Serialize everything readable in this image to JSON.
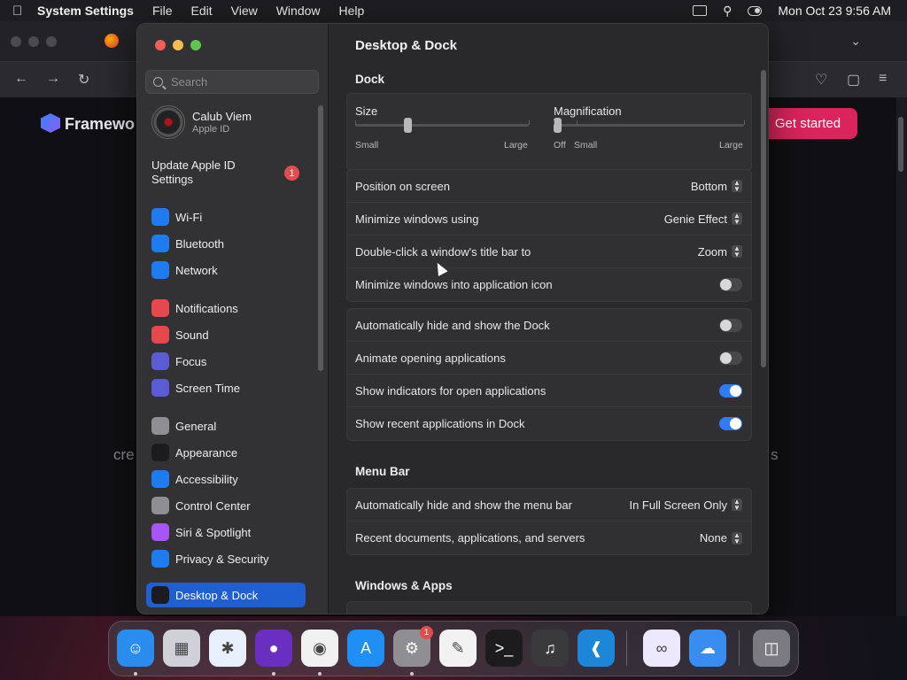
{
  "menubar": {
    "app": "System Settings",
    "items": [
      "File",
      "Edit",
      "View",
      "Window",
      "Help"
    ],
    "clock": "Mon Oct 23  9:56 AM"
  },
  "browser": {
    "brand": "Framewo",
    "cta": "Get started",
    "left_text": "cre",
    "right_text": "s"
  },
  "sidebar": {
    "search_placeholder": "Search",
    "profile_name": "Calub Viem",
    "profile_sub": "Apple ID",
    "update_label": "Update Apple ID Settings",
    "update_badge": "1",
    "items": [
      {
        "label": "Wi-Fi",
        "icon": "wifi-icon",
        "color": "#1f7cf0"
      },
      {
        "label": "Bluetooth",
        "icon": "bluetooth-icon",
        "color": "#1f7cf0"
      },
      {
        "label": "Network",
        "icon": "globe-icon",
        "color": "#1f7cf0"
      },
      {
        "label": "Notifications",
        "icon": "bell-icon",
        "color": "#e5484d"
      },
      {
        "label": "Sound",
        "icon": "speaker-icon",
        "color": "#e5484d"
      },
      {
        "label": "Focus",
        "icon": "moon-icon",
        "color": "#5b5bd6"
      },
      {
        "label": "Screen Time",
        "icon": "hourglass-icon",
        "color": "#5b5bd6"
      },
      {
        "label": "General",
        "icon": "gear-icon",
        "color": "#8e8e93"
      },
      {
        "label": "Appearance",
        "icon": "appearance-icon",
        "color": "#1c1c1e"
      },
      {
        "label": "Accessibility",
        "icon": "accessibility-icon",
        "color": "#1f7cf0"
      },
      {
        "label": "Control Center",
        "icon": "control-center-icon",
        "color": "#8e8e93"
      },
      {
        "label": "Siri & Spotlight",
        "icon": "siri-icon",
        "color": "#a855f7"
      },
      {
        "label": "Privacy & Security",
        "icon": "hand-icon",
        "color": "#1f7cf0"
      },
      {
        "label": "Desktop & Dock",
        "icon": "dock-icon",
        "color": "#1c1c1e"
      }
    ]
  },
  "main": {
    "title": "Desktop & Dock",
    "dock_section": "Dock",
    "size": {
      "label": "Size",
      "min_label": "Small",
      "max_label": "Large",
      "value": 0.3
    },
    "magnification": {
      "label": "Magnification",
      "off_label": "Off",
      "min_label": "Small",
      "max_label": "Large",
      "value": 0.0
    },
    "group1": [
      {
        "label": "Position on screen",
        "value": "Bottom"
      },
      {
        "label": "Minimize windows using",
        "value": "Genie Effect"
      },
      {
        "label": "Double-click a window's title bar to",
        "value": "Zoom"
      },
      {
        "label": "Minimize windows into application icon",
        "toggle": false
      }
    ],
    "group2": [
      {
        "label": "Automatically hide and show the Dock",
        "toggle": false
      },
      {
        "label": "Animate opening applications",
        "toggle": false
      },
      {
        "label": "Show indicators for open applications",
        "toggle": true
      },
      {
        "label": "Show recent applications in Dock",
        "toggle": true
      }
    ],
    "menubar_section": "Menu Bar",
    "group3": [
      {
        "label": "Automatically hide and show the menu bar",
        "value": "In Full Screen Only"
      },
      {
        "label": "Recent documents, applications, and servers",
        "value": "None"
      }
    ],
    "windows_section": "Windows & Apps"
  },
  "dock": {
    "apps": [
      {
        "name": "finder-icon",
        "color": "#2b8cf0"
      },
      {
        "name": "launchpad-icon",
        "color": "#d0d0d8"
      },
      {
        "name": "safari-icon",
        "color": "#e8f0ff"
      },
      {
        "name": "firefox-icon",
        "color": "#6a2fc0"
      },
      {
        "name": "chrome-icon",
        "color": "#f1f1f1"
      },
      {
        "name": "app-store-icon",
        "color": "#1f8ef5"
      },
      {
        "name": "system-settings-icon",
        "color": "#8e8e93"
      },
      {
        "name": "textedit-icon",
        "color": "#f2f2f2"
      },
      {
        "name": "terminal-icon",
        "color": "#1c1c1e"
      },
      {
        "name": "garageband-icon",
        "color": "#3a3a3c"
      },
      {
        "name": "vscode-icon",
        "color": "#1e86d8"
      },
      {
        "name": "visual-studio-icon",
        "color": "#eee8ff"
      },
      {
        "name": "weather-icon",
        "color": "#3a8df0"
      },
      {
        "name": "trash-icon",
        "color": "#7a7a80"
      }
    ],
    "settings_badge": "1"
  }
}
